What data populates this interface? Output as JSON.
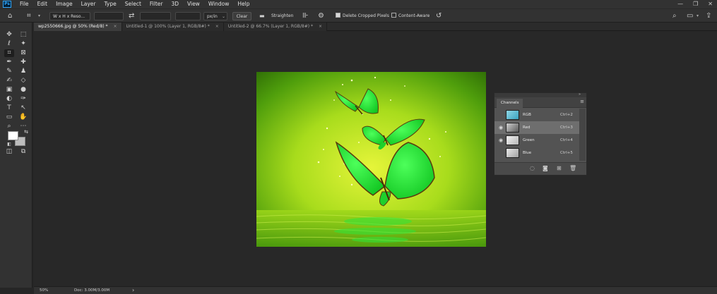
{
  "app": {
    "logo": "Ps"
  },
  "menu": [
    "File",
    "Edit",
    "Image",
    "Layer",
    "Type",
    "Select",
    "Filter",
    "3D",
    "View",
    "Window",
    "Help"
  ],
  "window_controls": {
    "minimize": "—",
    "restore": "❐",
    "close": "✕"
  },
  "options": {
    "ratio_value": "W x H x Reso...",
    "swap_icon": "swap-icon",
    "unit_value": "px/in",
    "clear_label": "Clear",
    "straighten_label": "Straighten",
    "delete_cropped_label": "Delete Cropped Pixels",
    "delete_cropped_checked": true,
    "content_aware_label": "Content-Aware",
    "content_aware_checked": false
  },
  "tabs": [
    {
      "label": "wp2550666.jpg @ 50% (Red/8) *",
      "active": true
    },
    {
      "label": "Untitled-1 @ 100% (Layer 1, RGB/8#) *",
      "active": false
    },
    {
      "label": "Untitled-2 @ 66.7% (Layer 1, RGB/8#) *",
      "active": false
    }
  ],
  "channels_panel": {
    "title": "Channels",
    "rows": [
      {
        "name": "RGB",
        "shortcut": "Ctrl+2",
        "visible": false,
        "selected": false,
        "thumb": "#6ec3d8"
      },
      {
        "name": "Red",
        "shortcut": "Ctrl+3",
        "visible": true,
        "selected": true,
        "thumb": "#9a9a9a"
      },
      {
        "name": "Green",
        "shortcut": "Ctrl+4",
        "visible": true,
        "selected": false,
        "thumb": "#e0e0e0"
      },
      {
        "name": "Blue",
        "shortcut": "Ctrl+5",
        "visible": false,
        "selected": false,
        "thumb": "#cfcfcf"
      }
    ]
  },
  "status": {
    "zoom": "50%",
    "doc": "Doc: 3.00M/3.00M",
    "arrow": "›"
  },
  "colors": {
    "accent": "#31a8ff",
    "image_green": "#6fe01a",
    "butterfly": "#1ee62e"
  }
}
